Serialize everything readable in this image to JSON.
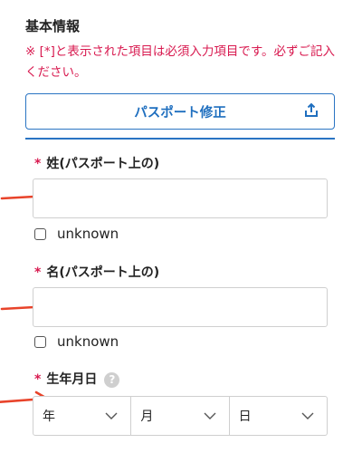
{
  "section": {
    "title": "基本情報"
  },
  "notice": {
    "text": "※ [*]と表示された項目は必須入力項目です。必ずご記入ください。"
  },
  "passport_button": {
    "label": "パスポート修正",
    "icon": "upload-icon"
  },
  "required_mark": "*",
  "last_name": {
    "label": "姓(パスポート上の)",
    "value": "",
    "unknown_label": "unknown",
    "unknown_checked": false
  },
  "first_name": {
    "label": "名(パスポート上の)",
    "value": "",
    "unknown_label": "unknown",
    "unknown_checked": false
  },
  "birthdate": {
    "label": "生年月日",
    "help_icon": "question-icon",
    "help_glyph": "?",
    "year_placeholder": "年",
    "month_placeholder": "月",
    "day_placeholder": "日"
  },
  "colors": {
    "accent": "#2a74c3",
    "required": "#d8194f",
    "annotation_arrow": "#e8432a"
  }
}
